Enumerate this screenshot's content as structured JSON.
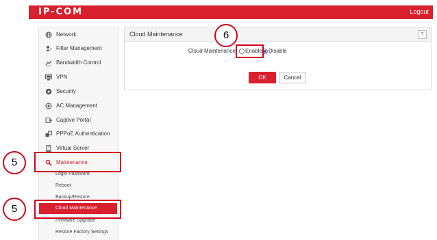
{
  "header": {
    "brand": "IP-COM",
    "logout_label": "Logout"
  },
  "sidebar": {
    "items": [
      {
        "label": "Network",
        "icon": "globe-icon"
      },
      {
        "label": "Filter Management",
        "icon": "filter-icon"
      },
      {
        "label": "Bandwidth Control",
        "icon": "bandwidth-icon"
      },
      {
        "label": "VPN",
        "icon": "vpn-icon"
      },
      {
        "label": "Security",
        "icon": "shield-icon"
      },
      {
        "label": "AC Management",
        "icon": "ac-icon"
      },
      {
        "label": "Captive Portal",
        "icon": "portal-icon"
      },
      {
        "label": "PPPoE Authentication",
        "icon": "pppoe-icon"
      },
      {
        "label": "Virtual Server",
        "icon": "server-icon"
      },
      {
        "label": "Maintenance",
        "icon": "wrench-icon"
      }
    ],
    "maintenance_subitems": [
      {
        "label": "Login Password"
      },
      {
        "label": "Reboot"
      },
      {
        "label": "Backup/Restore"
      },
      {
        "label": "Cloud Maintenance"
      },
      {
        "label": "Firmware Upgrade"
      },
      {
        "label": "Restore Factory Settings"
      }
    ]
  },
  "panel": {
    "title": "Cloud Maintenance",
    "help_label": "?",
    "field_label": "Cloud Maintenance:",
    "options": [
      {
        "label": "Enable",
        "checked": false
      },
      {
        "label": "Disable",
        "checked": true
      }
    ],
    "ok_label": "OK",
    "cancel_label": "Cancel"
  },
  "annotations": {
    "callouts": [
      "5",
      "5",
      "6"
    ]
  },
  "colors": {
    "brand_red": "#d8202e",
    "highlight_red": "#d0021b",
    "radio_blue": "#2a5bd7"
  }
}
